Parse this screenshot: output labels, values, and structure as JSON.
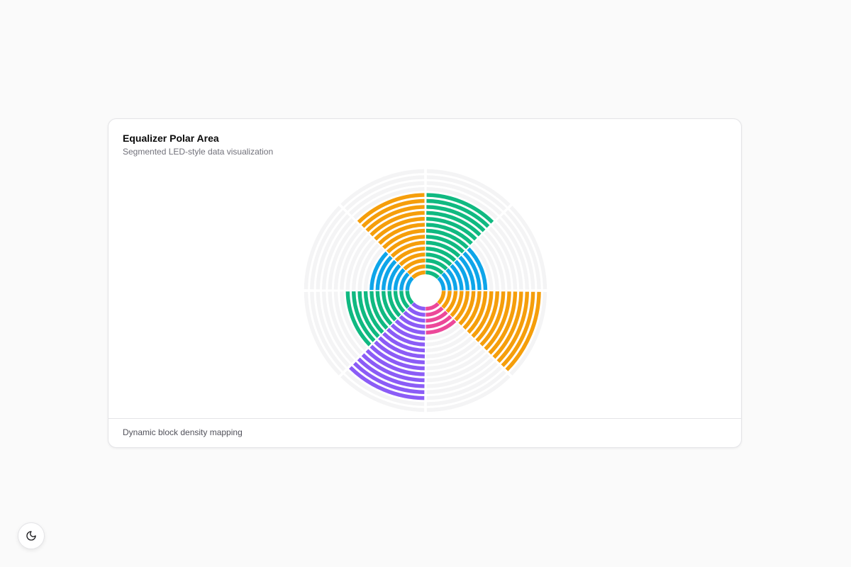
{
  "card": {
    "title": "Equalizer Polar Area",
    "subtitle": "Segmented LED-style data visualization",
    "footer": "Dynamic block density mapping"
  },
  "theme_toggle": {
    "icon": "moon-icon"
  },
  "chart_data": {
    "type": "polar-area",
    "title": "Equalizer Polar Area",
    "max_blocks": 18,
    "grid": true,
    "legend": "none",
    "start_angle_deg": 0,
    "direction": "clockwise",
    "segments": [
      {
        "value": 14,
        "color": "#10b981"
      },
      {
        "value": 8,
        "color": "#0ea5e9"
      },
      {
        "value": 17,
        "color": "#f59e0b"
      },
      {
        "value": 5,
        "color": "#ec4899"
      },
      {
        "value": 16,
        "color": "#8b5cf6"
      },
      {
        "value": 11,
        "color": "#10b981"
      },
      {
        "value": 7,
        "color": "#0ea5e9"
      },
      {
        "value": 14,
        "color": "#f59e0b"
      }
    ],
    "colors": {
      "grid": "#f4f4f5"
    }
  }
}
